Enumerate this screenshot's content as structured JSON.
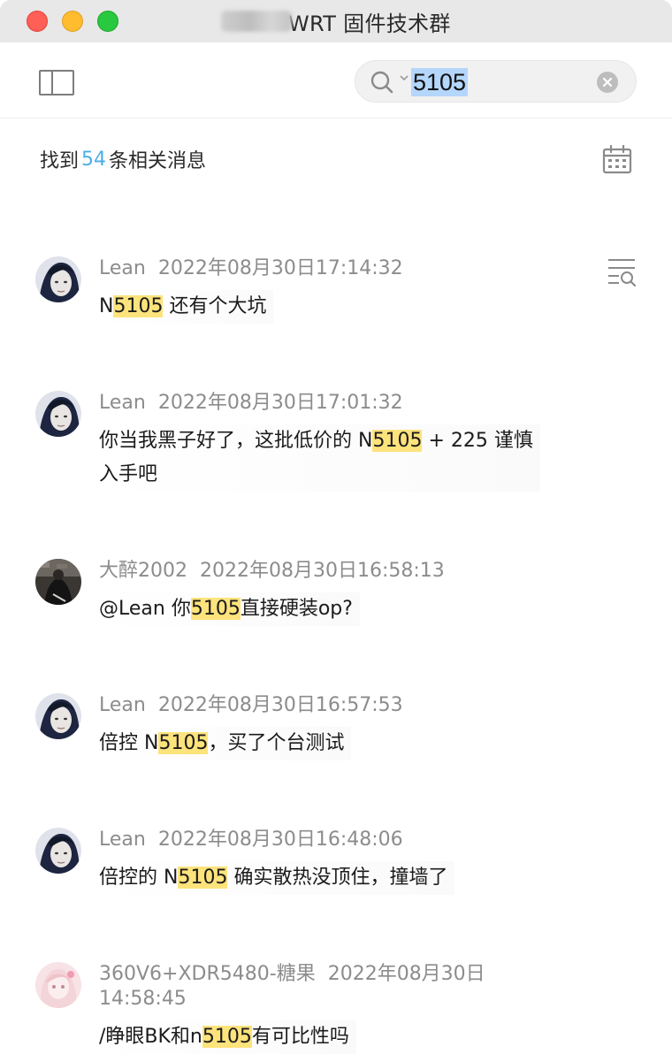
{
  "window": {
    "title": "WRT 固件技术群"
  },
  "toolbar": {
    "search": {
      "query": "5105"
    }
  },
  "results": {
    "prefix": "找到",
    "count": "54",
    "suffix": "条相关消息"
  },
  "messages": [
    {
      "sender": "Lean",
      "time": "2022年08月30日17:14:32",
      "avatar": "man-portrait",
      "segments": [
        {
          "text": "N"
        },
        {
          "text": "5105",
          "hl": true
        },
        {
          "text": " 还有个大坑"
        }
      ]
    },
    {
      "sender": "Lean",
      "time": "2022年08月30日17:01:32",
      "avatar": "man-portrait",
      "line1": [
        {
          "text": "你当我黑子好了，这批低价的 N"
        },
        {
          "text": "5105",
          "hl": true
        },
        {
          "text": " + 225 谨慎"
        }
      ],
      "line2": "入手吧"
    },
    {
      "sender": "大醉2002",
      "time": "2022年08月30日16:58:13",
      "avatar": "dark-figure",
      "segments": [
        {
          "text": "@Lean 你"
        },
        {
          "text": "5105",
          "hl": true
        },
        {
          "text": "直接硬装op?"
        }
      ]
    },
    {
      "sender": "Lean",
      "time": "2022年08月30日16:57:53",
      "avatar": "man-portrait",
      "segments": [
        {
          "text": "倍控 N"
        },
        {
          "text": "5105",
          "hl": true
        },
        {
          "text": "，买了个台测试"
        }
      ]
    },
    {
      "sender": "Lean",
      "time": "2022年08月30日16:48:06",
      "avatar": "man-portrait",
      "segments": [
        {
          "text": "倍控的 N"
        },
        {
          "text": "5105",
          "hl": true
        },
        {
          "text": " 确实散热没顶住，撞墙了"
        }
      ]
    },
    {
      "sender": "360V6+XDR5480-糖果",
      "time_line1": "2022年08月30日",
      "time_line2": "14:58:45",
      "avatar": "anime-girl",
      "segments": [
        {
          "text": "/睁眼BK和n"
        },
        {
          "text": "5105",
          "hl": true
        },
        {
          "text": "有可比性吗"
        }
      ]
    }
  ],
  "colors": {
    "highlight": "#fde37c",
    "count": "#4aaee5",
    "meta": "#8c8c8c",
    "selection": "#b4d6fb"
  },
  "icons": {
    "sidebar": "sidebar-toggle-icon",
    "search": "search-icon",
    "clear": "clear-icon",
    "calendar": "calendar-icon",
    "context": "message-context-icon"
  }
}
